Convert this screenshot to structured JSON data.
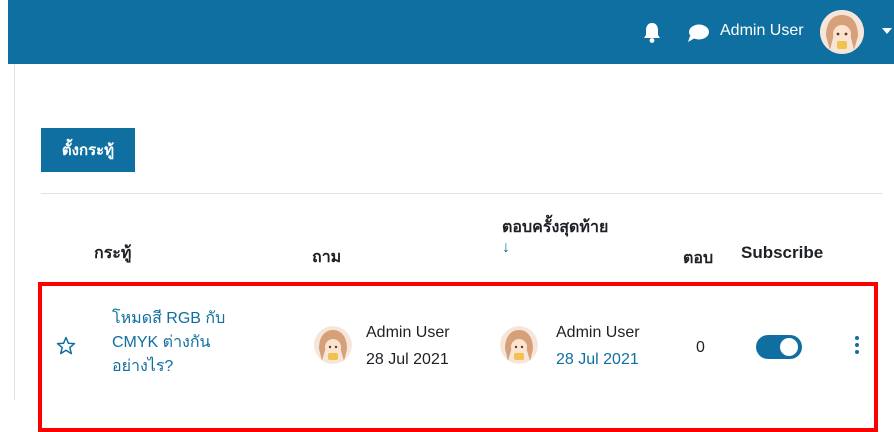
{
  "navbar": {
    "username": "Admin User",
    "icons": [
      "bell-icon",
      "chat-icon",
      "avatar",
      "chevron-down-icon"
    ],
    "bg_color": "#0f6fa0"
  },
  "discussion": {
    "add_button_label": "ตั้งกระทู้",
    "columns": {
      "topic": "กระทู้",
      "started_by": "ถาม",
      "last_post": "ตอบครั้งสุดท้าย",
      "last_post_sort": "↓",
      "replies": "ตอบ",
      "subscribe": "Subscribe"
    },
    "rows": [
      {
        "topic_lines": [
          "โหมดสี RGB กับ",
          "CMYK ต่างกัน",
          "อย่างไร?"
        ],
        "started_by": "Admin User",
        "started_date": "28 Jul 2021",
        "last_post_by": "Admin User",
        "last_post_date": "28 Jul 2021",
        "replies": "0",
        "subscribed": true
      }
    ]
  },
  "colors": {
    "accent": "#0f6fa0",
    "highlight": "#ff0000"
  }
}
